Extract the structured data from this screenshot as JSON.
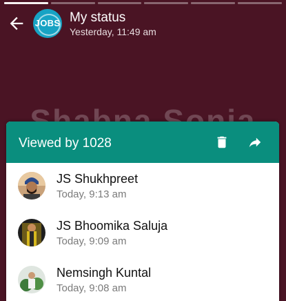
{
  "status": {
    "title": "My status",
    "subtitle": "Yesterday, 11:49 am",
    "avatar_text": "JOBS",
    "background_text": "Shabna Sonia",
    "segments": 6,
    "active_segment": 0
  },
  "viewers_panel": {
    "title": "Viewed by 1028",
    "delete_icon": "trash-icon",
    "forward_icon": "share-arrow-icon"
  },
  "viewers": [
    {
      "name": "JS Shukhpreet",
      "time": "Today, 9:13 am"
    },
    {
      "name": "JS Bhoomika Saluja",
      "time": "Today, 9:09 am"
    },
    {
      "name": "Nemsingh Kuntal",
      "time": "Today, 9:08 am"
    }
  ],
  "colors": {
    "status_background": "#4a1424",
    "panel_header": "#0a8e7e",
    "avatar_logo": "#17a3c4"
  }
}
